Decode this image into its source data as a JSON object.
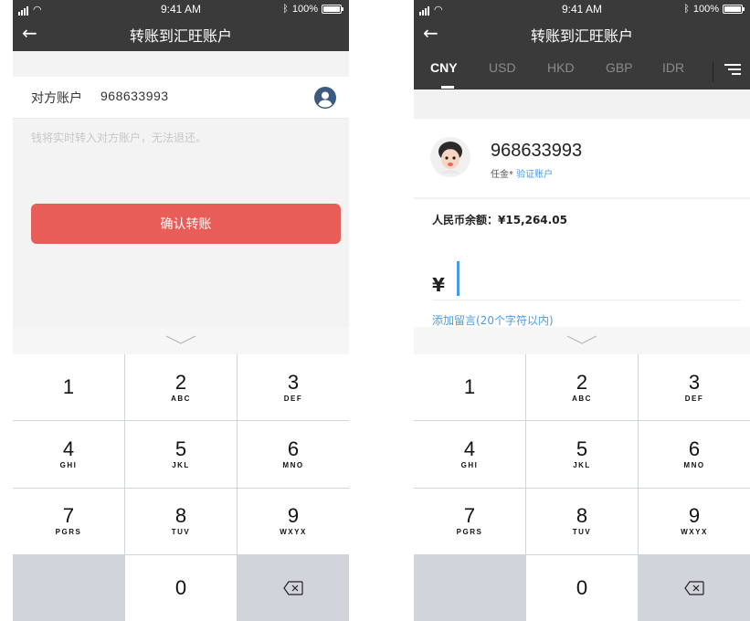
{
  "status": {
    "time": "9:41 AM",
    "battery": "100%"
  },
  "title": "转账到汇旺账户",
  "left": {
    "account_label": "对方账户",
    "account_number": "968633993",
    "hint": "钱将实时转入对方账户，无法退还。",
    "confirm_label": "确认转账"
  },
  "right": {
    "tabs": [
      "CNY",
      "USD",
      "HKD",
      "GBP",
      "IDR"
    ],
    "active_tab": "CNY",
    "payee_number": "968633993",
    "payee_name": "任金*",
    "verify_link": "验证账户",
    "balance_label": "人民币余额：¥15,264.05",
    "currency_symbol": "¥",
    "add_note": "添加留言(20个字符以内)"
  },
  "keypad": [
    {
      "digit": "1",
      "letters": ""
    },
    {
      "digit": "2",
      "letters": "ABC"
    },
    {
      "digit": "3",
      "letters": "DEF"
    },
    {
      "digit": "4",
      "letters": "GHI"
    },
    {
      "digit": "5",
      "letters": "JKL"
    },
    {
      "digit": "6",
      "letters": "MNO"
    },
    {
      "digit": "7",
      "letters": "PGRS"
    },
    {
      "digit": "8",
      "letters": "TUV"
    },
    {
      "digit": "9",
      "letters": "WXYX"
    },
    {
      "digit": "",
      "letters": ""
    },
    {
      "digit": "0",
      "letters": ""
    },
    {
      "digit": "",
      "letters": ""
    }
  ],
  "icons": {
    "back": "arrow-left-icon",
    "user": "user-circle-icon",
    "menu": "menu-icon",
    "delete": "backspace-icon",
    "collapse": "chevron-down-icon"
  },
  "colors": {
    "header": "#3a3a3a",
    "confirm_button": "#e85d58",
    "link": "#4a9be6",
    "user_icon": "#3d5a80"
  }
}
